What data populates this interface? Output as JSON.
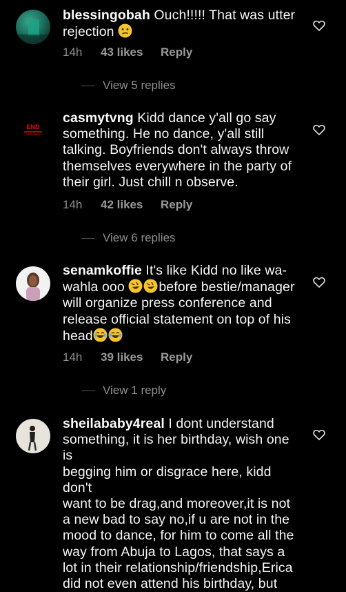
{
  "comments": [
    {
      "username": "blessingobah",
      "text": " Ouch!!!!! That was utter\nrejection",
      "emoji_after": "😕",
      "time": "14h",
      "likes": "43 likes",
      "reply": "Reply",
      "view_replies": "View 5 replies"
    },
    {
      "username": "casmytvng",
      "text": " Kidd dance y'all go say\nsomething. He no dance, y'all still\ntalking. Boyfriends don't always throw\nthemselves everywhere in the party of\ntheir girl. Just chill n observe.",
      "avatar_text": "END",
      "time": "14h",
      "likes": "42 likes",
      "reply": "Reply",
      "view_replies": "View 6 replies"
    },
    {
      "username": "senamkoffie",
      "text_a": " It's like Kidd no like wa-\nwahla ooo ",
      "text_b": "before bestie/manager\nwill organize press conference and\nrelease official statement  on top of his\nhead",
      "time": "14h",
      "likes": "39 likes",
      "reply": "Reply",
      "view_replies": "View 1 reply"
    },
    {
      "username": "sheilababy4real",
      "text": " I dont understand\nsomething, it is her birthday, wish one is\nbegging him or disgrace here, kidd don't\nwant to be drag,and moreover,it is not\na new bad  to say no,if u are not in the\nmood to dance, for him to come  all the\nway from Abuja to Lagos, that says a\nlot in their relationship/friendship,Erica\ndid not even attend his birthday, but"
    }
  ],
  "icons": {
    "like": "heart-outline-icon",
    "emoji_confused": "confused-face-icon",
    "emoji_rofl": "rolling-laughing-face-icon",
    "emoji_joy": "tears-of-joy-face-icon"
  },
  "colors": {
    "background": "#000000",
    "text": "#f5f5f5",
    "muted": "#8e8e8e"
  }
}
